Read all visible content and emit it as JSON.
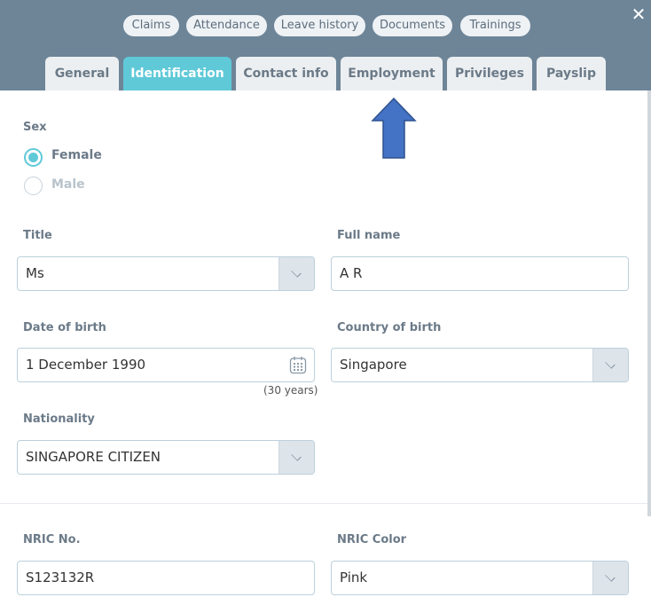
{
  "top_links": [
    {
      "label": "Claims"
    },
    {
      "label": "Attendance"
    },
    {
      "label": "Leave history"
    },
    {
      "label": "Documents"
    },
    {
      "label": "Trainings"
    }
  ],
  "close_label": "✕",
  "tabs": [
    {
      "label": "General",
      "active": false
    },
    {
      "label": "Identification",
      "active": true
    },
    {
      "label": "Contact info",
      "active": false
    },
    {
      "label": "Employment",
      "active": false
    },
    {
      "label": "Privileges",
      "active": false
    },
    {
      "label": "Payslip",
      "active": false
    }
  ],
  "annotation": {
    "icon": "up-arrow-icon",
    "color": "#4472c4"
  },
  "form": {
    "sex": {
      "label": "Sex",
      "options": [
        {
          "label": "Female",
          "checked": true
        },
        {
          "label": "Male",
          "checked": false
        }
      ]
    },
    "title": {
      "label": "Title",
      "value": "Ms"
    },
    "full_name": {
      "label": "Full name",
      "value": "A R"
    },
    "dob": {
      "label": "Date of birth",
      "value": "1 December 1990",
      "age": "(30 years)"
    },
    "country_of_birth": {
      "label": "Country of birth",
      "value": "Singapore"
    },
    "nationality": {
      "label": "Nationality",
      "value": "SINGAPORE CITIZEN"
    },
    "nric_no": {
      "label": "NRIC No.",
      "value": "S123132R"
    },
    "nric_color": {
      "label": "NRIC Color",
      "value": "Pink"
    }
  },
  "colors": {
    "header": "#6e8598",
    "accent": "#5fc9d8"
  }
}
